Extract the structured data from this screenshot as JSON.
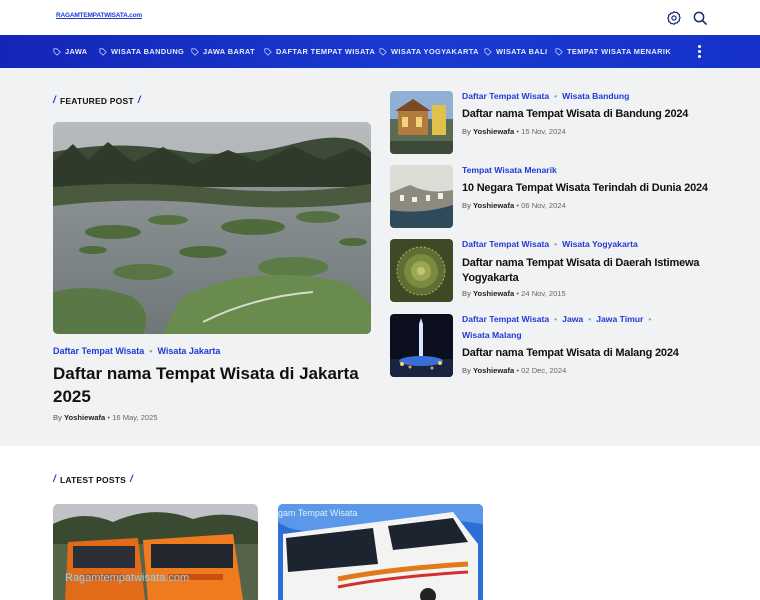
{
  "site": {
    "logo_text": "RAGAMTEMPATWISATA.com"
  },
  "header": {
    "settings_icon": "gear-icon",
    "search_icon": "search-icon"
  },
  "nav": {
    "items": [
      {
        "label": "JAWA"
      },
      {
        "label": "WISATA BANDUNG"
      },
      {
        "label": "JAWA BARAT"
      },
      {
        "label": "DAFTAR TEMPAT WISATA"
      },
      {
        "label": "WISATA YOGYAKARTA"
      },
      {
        "label": "WISATA BALI"
      },
      {
        "label": "TEMPAT WISATA MENARIK"
      }
    ],
    "more_icon": "more-vertical-icon"
  },
  "featured": {
    "section_title": "FEATURED POST",
    "main": {
      "cat1": "Daftar Tempat Wisata",
      "cat2": "Wisata Jakarta",
      "title": "Daftar nama Tempat Wisata di Jakarta 2025",
      "by": "By",
      "author": "Yoshiewafa",
      "date": "16 May, 2025"
    },
    "side": [
      {
        "cat1": "Daftar Tempat Wisata",
        "cat2": "Wisata Bandung",
        "title": "Daftar nama Tempat Wisata di Bandung 2024",
        "by": "By",
        "author": "Yoshiewafa",
        "date": "15 Nov, 2024"
      },
      {
        "cat1": "Tempat Wisata Menarik",
        "title": "10 Negara Tempat Wisata Terindah di Dunia 2024",
        "by": "By",
        "author": "Yoshiewafa",
        "date": "06 Nov, 2024"
      },
      {
        "cat1": "Daftar Tempat Wisata",
        "cat2": "Wisata Yogyakarta",
        "title": "Daftar nama Tempat Wisata di Daerah Istimewa Yogyakarta",
        "by": "By",
        "author": "Yoshiewafa",
        "date": "24 Nov, 2015"
      },
      {
        "cat1": "Daftar Tempat Wisata",
        "cat2": "Jawa",
        "cat3": "Jawa Timur",
        "cat4": "Wisata Malang",
        "title": "Daftar nama Tempat Wisata di Malang 2024",
        "by": "By",
        "author": "Yoshiewafa",
        "date": "02 Dec, 2024"
      }
    ]
  },
  "latest": {
    "section_title": "LATEST POSTS",
    "cards": [
      {
        "watermark": "Ragamtempatwisata.com"
      },
      {
        "watermark": "gam Tempat Wisata"
      }
    ]
  },
  "colors": {
    "accent": "#1e3bd6",
    "nav_bg": "#1a3ad0",
    "section_bg": "#f1f2f4"
  }
}
